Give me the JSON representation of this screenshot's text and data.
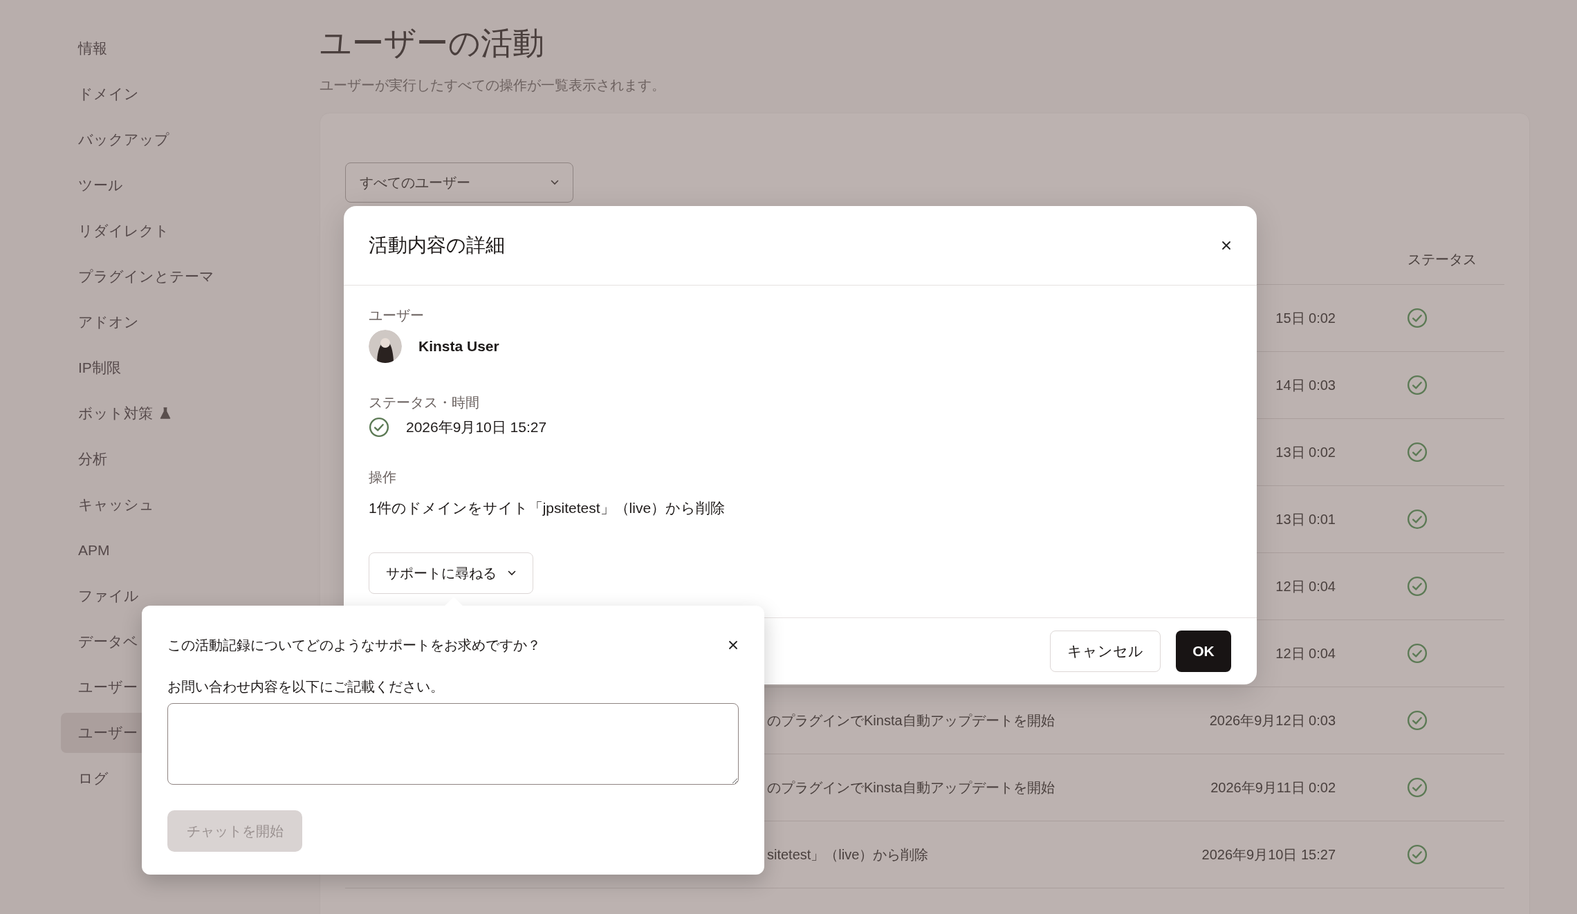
{
  "sidebar": {
    "items": [
      {
        "label": "情報",
        "selected": false,
        "experimental": false
      },
      {
        "label": "ドメイン",
        "selected": false,
        "experimental": false
      },
      {
        "label": "バックアップ",
        "selected": false,
        "experimental": false
      },
      {
        "label": "ツール",
        "selected": false,
        "experimental": false
      },
      {
        "label": "リダイレクト",
        "selected": false,
        "experimental": false
      },
      {
        "label": "プラグインとテーマ",
        "selected": false,
        "experimental": false
      },
      {
        "label": "アドオン",
        "selected": false,
        "experimental": false
      },
      {
        "label": "IP制限",
        "selected": false,
        "experimental": false
      },
      {
        "label": "ボット対策",
        "selected": false,
        "experimental": true
      },
      {
        "label": "分析",
        "selected": false,
        "experimental": false
      },
      {
        "label": "キャッシュ",
        "selected": false,
        "experimental": false
      },
      {
        "label": "APM",
        "selected": false,
        "experimental": false
      },
      {
        "label": "ファイル",
        "selected": false,
        "experimental": false
      },
      {
        "label": "データベ",
        "selected": false,
        "experimental": false
      },
      {
        "label": "ユーザー",
        "selected": false,
        "experimental": false
      },
      {
        "label": "ユーザー",
        "selected": true,
        "experimental": false
      },
      {
        "label": "ログ",
        "selected": false,
        "experimental": false
      }
    ]
  },
  "page": {
    "title": "ユーザーの活動",
    "subtitle": "ユーザーが実行したすべての操作が一覧表示されます。",
    "filter": "すべてのユーザー",
    "table": {
      "columns": [
        {
          "label": "ステータス"
        }
      ],
      "rows": [
        {
          "date": "15日 0:02",
          "status": true
        },
        {
          "date": "14日 0:03",
          "status": true
        },
        {
          "date": "13日 0:02",
          "status": true
        },
        {
          "date": "13日 0:01",
          "status": true
        },
        {
          "date": "12日 0:04",
          "status": true
        },
        {
          "date": "12日 0:04",
          "status": true
        },
        {
          "action": "のプラグインでKinsta自動アップデートを開始",
          "date": "2026年9月12日 0:03",
          "status": true
        },
        {
          "action": "のプラグインでKinsta自動アップデートを開始",
          "date": "2026年9月11日 0:02",
          "status": true
        },
        {
          "action": "sitetest」（live）から削除",
          "date": "2026年9月10日 15:27",
          "status": true
        }
      ]
    }
  },
  "modal": {
    "title": "活動内容の詳細",
    "user_label": "ユーザー",
    "user_name": "Kinsta User",
    "status_label": "ステータス・時間",
    "status": true,
    "time": "2026年9月10日 15:27",
    "operation_label": "操作",
    "operation": "1件のドメインをサイト「jpsitetest」（live）から削除",
    "support_button": {
      "label": "サポートに尋ねる",
      "expanded": true
    },
    "cancel": "キャンセル",
    "ok": "OK"
  },
  "popover": {
    "question": "この活動記録についてどのようなサポートをお求めですか？",
    "label": "お問い合わせ内容を以下にご記載ください。",
    "chat_button": {
      "label": "チャットを開始",
      "disabled": true
    }
  }
}
